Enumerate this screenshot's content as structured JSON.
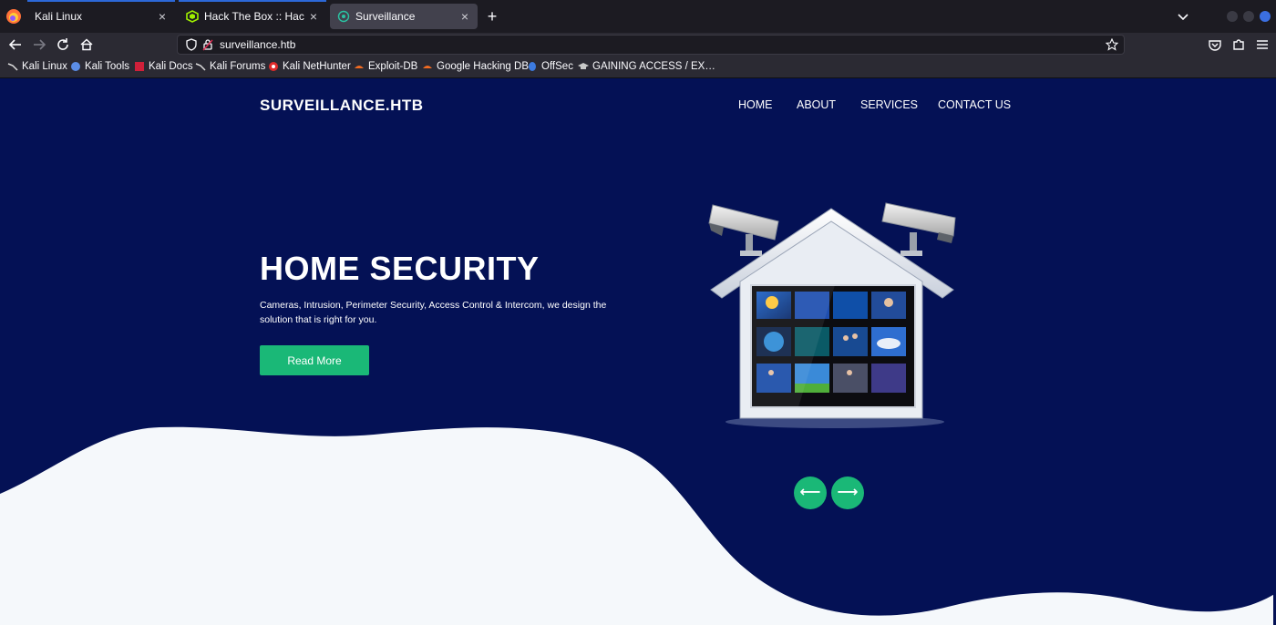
{
  "browser": {
    "tabs": [
      {
        "title": "Kali Linux"
      },
      {
        "title": "Hack The Box :: Hack The"
      },
      {
        "title": "Surveillance"
      }
    ],
    "url": "surveillance.htb",
    "bookmarks": [
      "Kali Linux",
      "Kali Tools",
      "Kali Docs",
      "Kali Forums",
      "Kali NetHunter",
      "Exploit-DB",
      "Google Hacking DB",
      "OffSec",
      "GAINING ACCESS / EX…"
    ],
    "close_glyph": "×",
    "newtab_glyph": "+"
  },
  "site": {
    "brand": "SURVEILLANCE.HTB",
    "nav": [
      "HOME",
      "ABOUT",
      "SERVICES",
      "CONTACT US"
    ],
    "hero": {
      "title": "HOME SECURITY",
      "text": "Cameras, Intrusion, Perimeter Security, Access Control & Intercom, we design the solution that is right for you.",
      "button": "Read More"
    },
    "prev_glyph": "⟵",
    "next_glyph": "⟶"
  },
  "colors": {
    "page_bg": "#041155",
    "accent": "#1ab877",
    "wave": "#f5f8fb",
    "chrome_bg": "#1c1b22",
    "toolbar_bg": "#2b2a33"
  }
}
